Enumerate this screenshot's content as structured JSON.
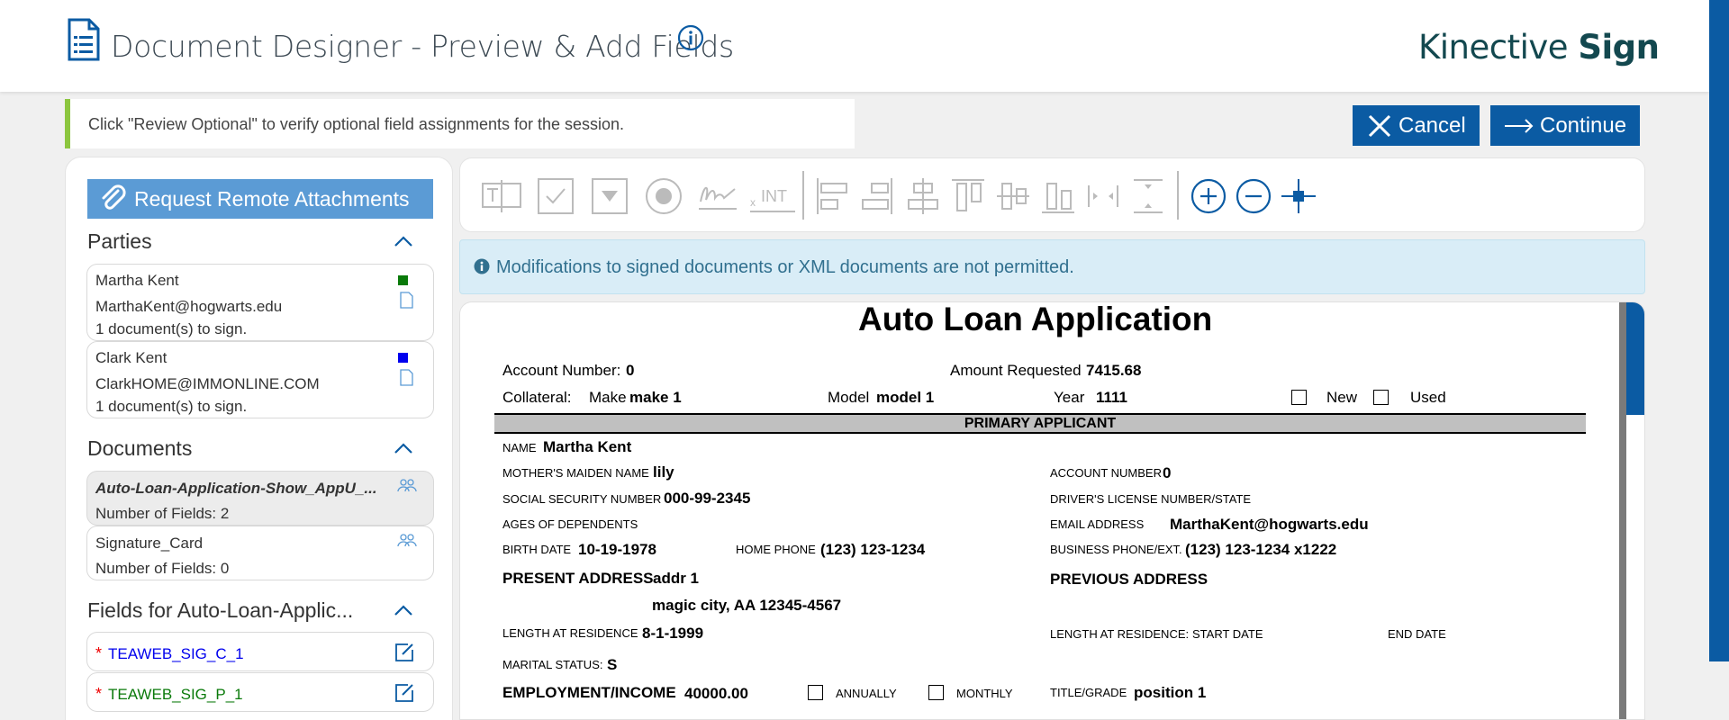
{
  "header": {
    "title": "Document Designer - Preview & Add Fields",
    "brand_light": "Kinective ",
    "brand_bold": "Sign"
  },
  "notice": {
    "text": "Click \"Review Optional\" to verify optional field assignments for the session."
  },
  "actions": {
    "cancel_label": "Cancel",
    "continue_label": "Continue"
  },
  "sidebar": {
    "request_attachments_label": "Request Remote Attachments",
    "parties_heading": "Parties",
    "parties": [
      {
        "name": "Martha Kent",
        "email": "MarthaKent@hogwarts.edu",
        "docs": "1 document(s) to sign.",
        "color": "#0a7a0a"
      },
      {
        "name": "Clark Kent",
        "email": "ClarkHOME@IMMONLINE.COM",
        "docs": "1 document(s) to sign.",
        "color": "#0000ee"
      }
    ],
    "documents_heading": "Documents",
    "documents": [
      {
        "name": "Auto-Loan-Application-Show_AppU_...",
        "fields": "Number of Fields: 2"
      },
      {
        "name": "Signature_Card",
        "fields": "Number of Fields: 0"
      }
    ],
    "fields_heading": "Fields for Auto-Loan-Applic...",
    "fields": [
      {
        "name": "TEAWEB_SIG_C_1",
        "required_mark": "*",
        "color": "#0000ee"
      },
      {
        "name": "TEAWEB_SIG_P_1",
        "required_mark": "*",
        "color": "#0a7a0a"
      }
    ]
  },
  "toolbar": {
    "tools": [
      "text-field-tool",
      "checkbox-tool",
      "dropdown-tool",
      "radio-tool",
      "signature-tool",
      "initials-tool",
      "align-left-tool",
      "align-right-tool",
      "align-center-tool",
      "align-top-tool",
      "align-middle-tool",
      "align-bottom-tool",
      "distribute-horizontal-tool",
      "distribute-vertical-tool",
      "zoom-in-tool",
      "zoom-out-tool",
      "move-tool"
    ],
    "initials_label": "INT",
    "initials_prefix": "x"
  },
  "info_banner": {
    "text": "Modifications to signed documents or XML documents are not permitted."
  },
  "document": {
    "title": "Auto Loan Application",
    "account_number_label": "Account Number:",
    "account_number_value": "0",
    "amount_requested_label": "Amount Requested",
    "amount_requested_value": "7415.68",
    "collateral_label": "Collateral:",
    "make_label": "Make",
    "make_value": "make 1",
    "model_label": "Model",
    "model_value": "model 1",
    "year_label": "Year",
    "year_value": "1111",
    "new_label": "New",
    "used_label": "Used",
    "primary_applicant": "PRIMARY APPLICANT",
    "name_label": "NAME",
    "name_value": "Martha Kent",
    "maiden_label": "MOTHER'S MAIDEN NAME",
    "maiden_value": "lily",
    "acct_num_label": "ACCOUNT NUMBER",
    "acct_num_value": "0",
    "ssn_label": "SOCIAL SECURITY NUMBER",
    "ssn_value": "000-99-2345",
    "dl_label": "DRIVER'S LICENSE NUMBER/STATE",
    "dependents_label": "AGES OF DEPENDENTS",
    "email_label": "EMAIL ADDRESS",
    "email_value": "MarthaKent@hogwarts.edu",
    "birth_label": "BIRTH DATE",
    "birth_value": "10-19-1978",
    "home_phone_label": "HOME PHONE",
    "home_phone_value": "(123) 123-1234",
    "business_phone_label": "BUSINESS PHONE/EXT.",
    "business_phone_value": "(123) 123-1234 x1222",
    "present_address_label": "PRESENT ADDRESS",
    "present_address_line1": "addr 1",
    "present_address_line2": "magic city, AA 12345-4567",
    "previous_address_label": "PREVIOUS ADDRESS",
    "length_residence_label": "LENGTH AT RESIDENCE",
    "length_residence_value": "8-1-1999",
    "length_residence_label2": "LENGTH AT RESIDENCE:",
    "start_date_label": "START DATE",
    "end_date_label": "END DATE",
    "marital_label": "MARITAL STATUS:",
    "marital_value": "S",
    "employment_label": "EMPLOYMENT/INCOME",
    "employment_value": "40000.00",
    "annually_label": "ANNUALLY",
    "monthly_label": "MONTHLY",
    "title_grade_label": "TITLE/GRADE",
    "title_grade_value": "position 1"
  }
}
